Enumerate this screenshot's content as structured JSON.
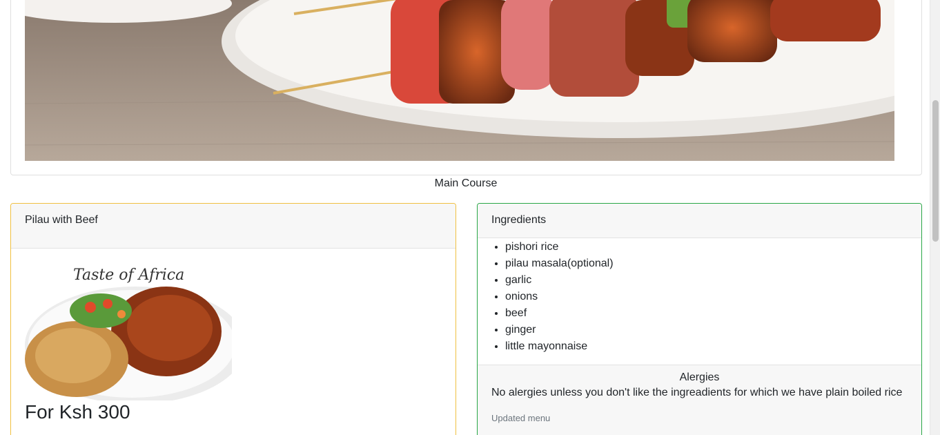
{
  "hero": {
    "image": "grilled-kebab-skewers-photo"
  },
  "section": {
    "caption": "Main Course"
  },
  "dish": {
    "title": "Pilau with Beef",
    "image": "pilau-with-beef-photo",
    "image_watermark": "Taste of Africa",
    "price": "For Ksh 300",
    "accent_color": "#f0c040"
  },
  "ingredients": {
    "title": "Ingredients",
    "items": [
      "pishori rice",
      "pilau masala(optional)",
      "garlic",
      "onions",
      "beef",
      "ginger",
      "little mayonnaise"
    ],
    "accent_color": "#28a745"
  },
  "allergies": {
    "title": "Alergies",
    "text": "No alergies unless you don't like the ingreadients for which we have plain boiled rice",
    "footer": "Updated menu"
  }
}
